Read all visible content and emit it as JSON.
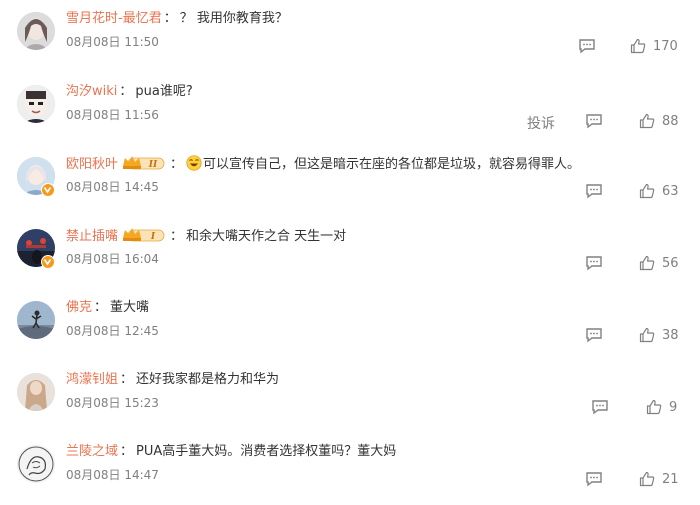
{
  "colors": {
    "username": "#eb7350",
    "text": "#333333",
    "meta": "#808080",
    "vip": "#f59a1f"
  },
  "comments": [
    {
      "user": "雪月花时-最忆君",
      "text": "？ 我用你教育我？",
      "time": "08月08日 11:50",
      "likes": "170",
      "avatar_icon": "avatar-woman-icon"
    },
    {
      "user": "沟汐wiki",
      "text": "pua谁呢?",
      "time": "08月08日 11:56",
      "likes": "88",
      "report": "投诉",
      "avatar_icon": "avatar-face-icon"
    },
    {
      "user": "欧阳秋叶",
      "badge": "II",
      "text": "可以宣传自己，但这是暗示在座的各位都是垃圾，就容易得罪人。",
      "time": "08月08日 14:45",
      "likes": "63",
      "avatar_icon": "avatar-girl-icon"
    },
    {
      "user": "禁止插嘴",
      "badge": "I",
      "text": "和余大嘴天作之合 天生一对",
      "time": "08月08日 16:04",
      "likes": "56",
      "avatar_icon": "avatar-scene-icon"
    },
    {
      "user": "佛克",
      "text": "董大嘴",
      "time": "08月08日 12:45",
      "likes": "38",
      "avatar_icon": "avatar-jump-icon"
    },
    {
      "user": "鸿濛钊姐",
      "text": "还好我家都是格力和华为",
      "time": "08月08日 15:23",
      "likes": "9",
      "avatar_icon": "avatar-lady-icon"
    },
    {
      "user": "兰陵之域",
      "text": "PUA高手董大妈。消费者选择权董吗？董大妈",
      "time": "08月08日 14:47",
      "likes": "21",
      "avatar_icon": "avatar-sketch-icon"
    }
  ]
}
